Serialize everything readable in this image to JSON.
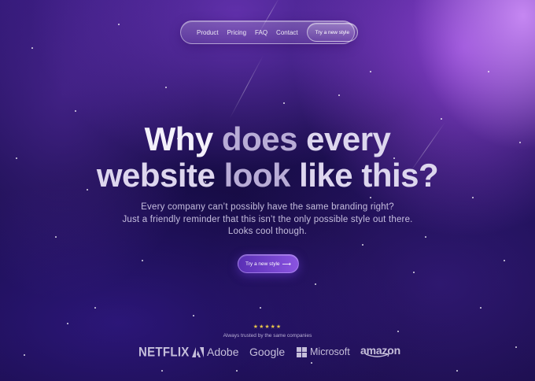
{
  "nav": {
    "links": [
      "Product",
      "Pricing",
      "FAQ",
      "Contact"
    ],
    "cta_label": "Try a new style"
  },
  "hero": {
    "title_line1": [
      "Why",
      "does",
      "every"
    ],
    "title_line2": [
      "website",
      "look",
      "like",
      "this?"
    ],
    "subtitle_line1": "Every company can’t possibly have the same branding right?",
    "subtitle_line2": "Just a friendly reminder that this isn’t the only possible style out there.",
    "subtitle_line3": "Looks cool though.",
    "cta_label": "Try a new style",
    "cta_arrow": "⟶"
  },
  "trust": {
    "stars": "★★★★★",
    "rating": 5,
    "label": "Always trusted by the same companies",
    "logos": [
      "NETFLIX",
      "Adobe",
      "Google",
      "Microsoft",
      "amazon"
    ]
  },
  "colors": {
    "background": "#1b0f52",
    "accent_glow": "#b06bf0",
    "cta_gradient_start": "#5a2fb5",
    "cta_gradient_end": "#8a54e0",
    "star_gold": "#e6c44a"
  }
}
